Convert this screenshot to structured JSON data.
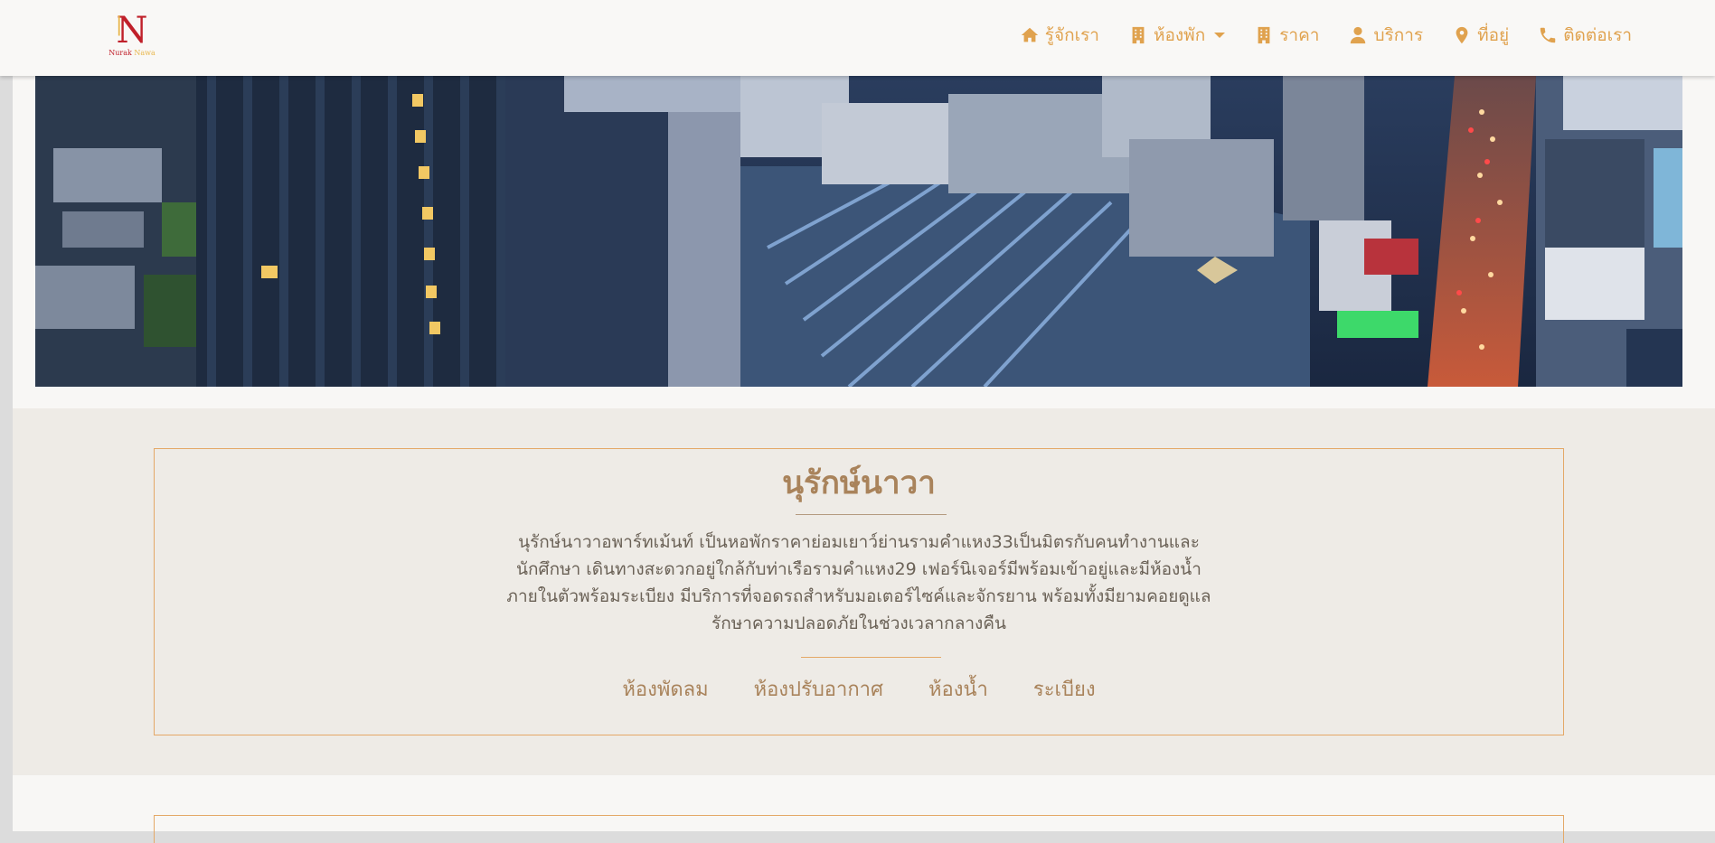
{
  "brand": {
    "logo_letter": "N",
    "wordmark_part1": "Nurak",
    "wordmark_part2": "Nawa"
  },
  "nav": {
    "items": [
      {
        "label": "รู้จักเรา",
        "icon": "home-icon"
      },
      {
        "label": "ห้องพัก",
        "icon": "building-icon",
        "dropdown": true
      },
      {
        "label": "ราคา",
        "icon": "building-icon"
      },
      {
        "label": "บริการ",
        "icon": "user-icon"
      },
      {
        "label": "ที่อยู่",
        "icon": "map-pin-icon"
      },
      {
        "label": "ติดต่อเรา",
        "icon": "phone-icon"
      }
    ]
  },
  "about": {
    "title": "นุรักษ์นาวา",
    "description": "นุรักษ์นาวาอพาร์ทเม้นท์ เป็นหอพักราคาย่อมเยาว์ย่านรามคำแหง33เป็นมิตรกับคนทำงานและนักศึกษา เดินทางสะดวกอยู่ใกล้กับท่าเรือรามคำแหง29 เฟอร์นิเจอร์มีพร้อมเข้าอยู่และมีห้องน้ำภายในตัวพร้อมระเบียง มีบริการที่จอดรถสำหรับมอเตอร์ไซค์และจักรยาน พร้อมทั้งมียามคอยดูแลรักษาความปลอดภัยในช่วงเวลากลางคืน",
    "features": [
      "ห้องพัดลม",
      "ห้องปรับอากาศ",
      "ห้องน้ำ",
      "ระเบียง"
    ]
  },
  "colors": {
    "accent": "#e0a24e",
    "heading": "#a9835b",
    "band": "#eeebe6",
    "border": "#e4a867"
  }
}
